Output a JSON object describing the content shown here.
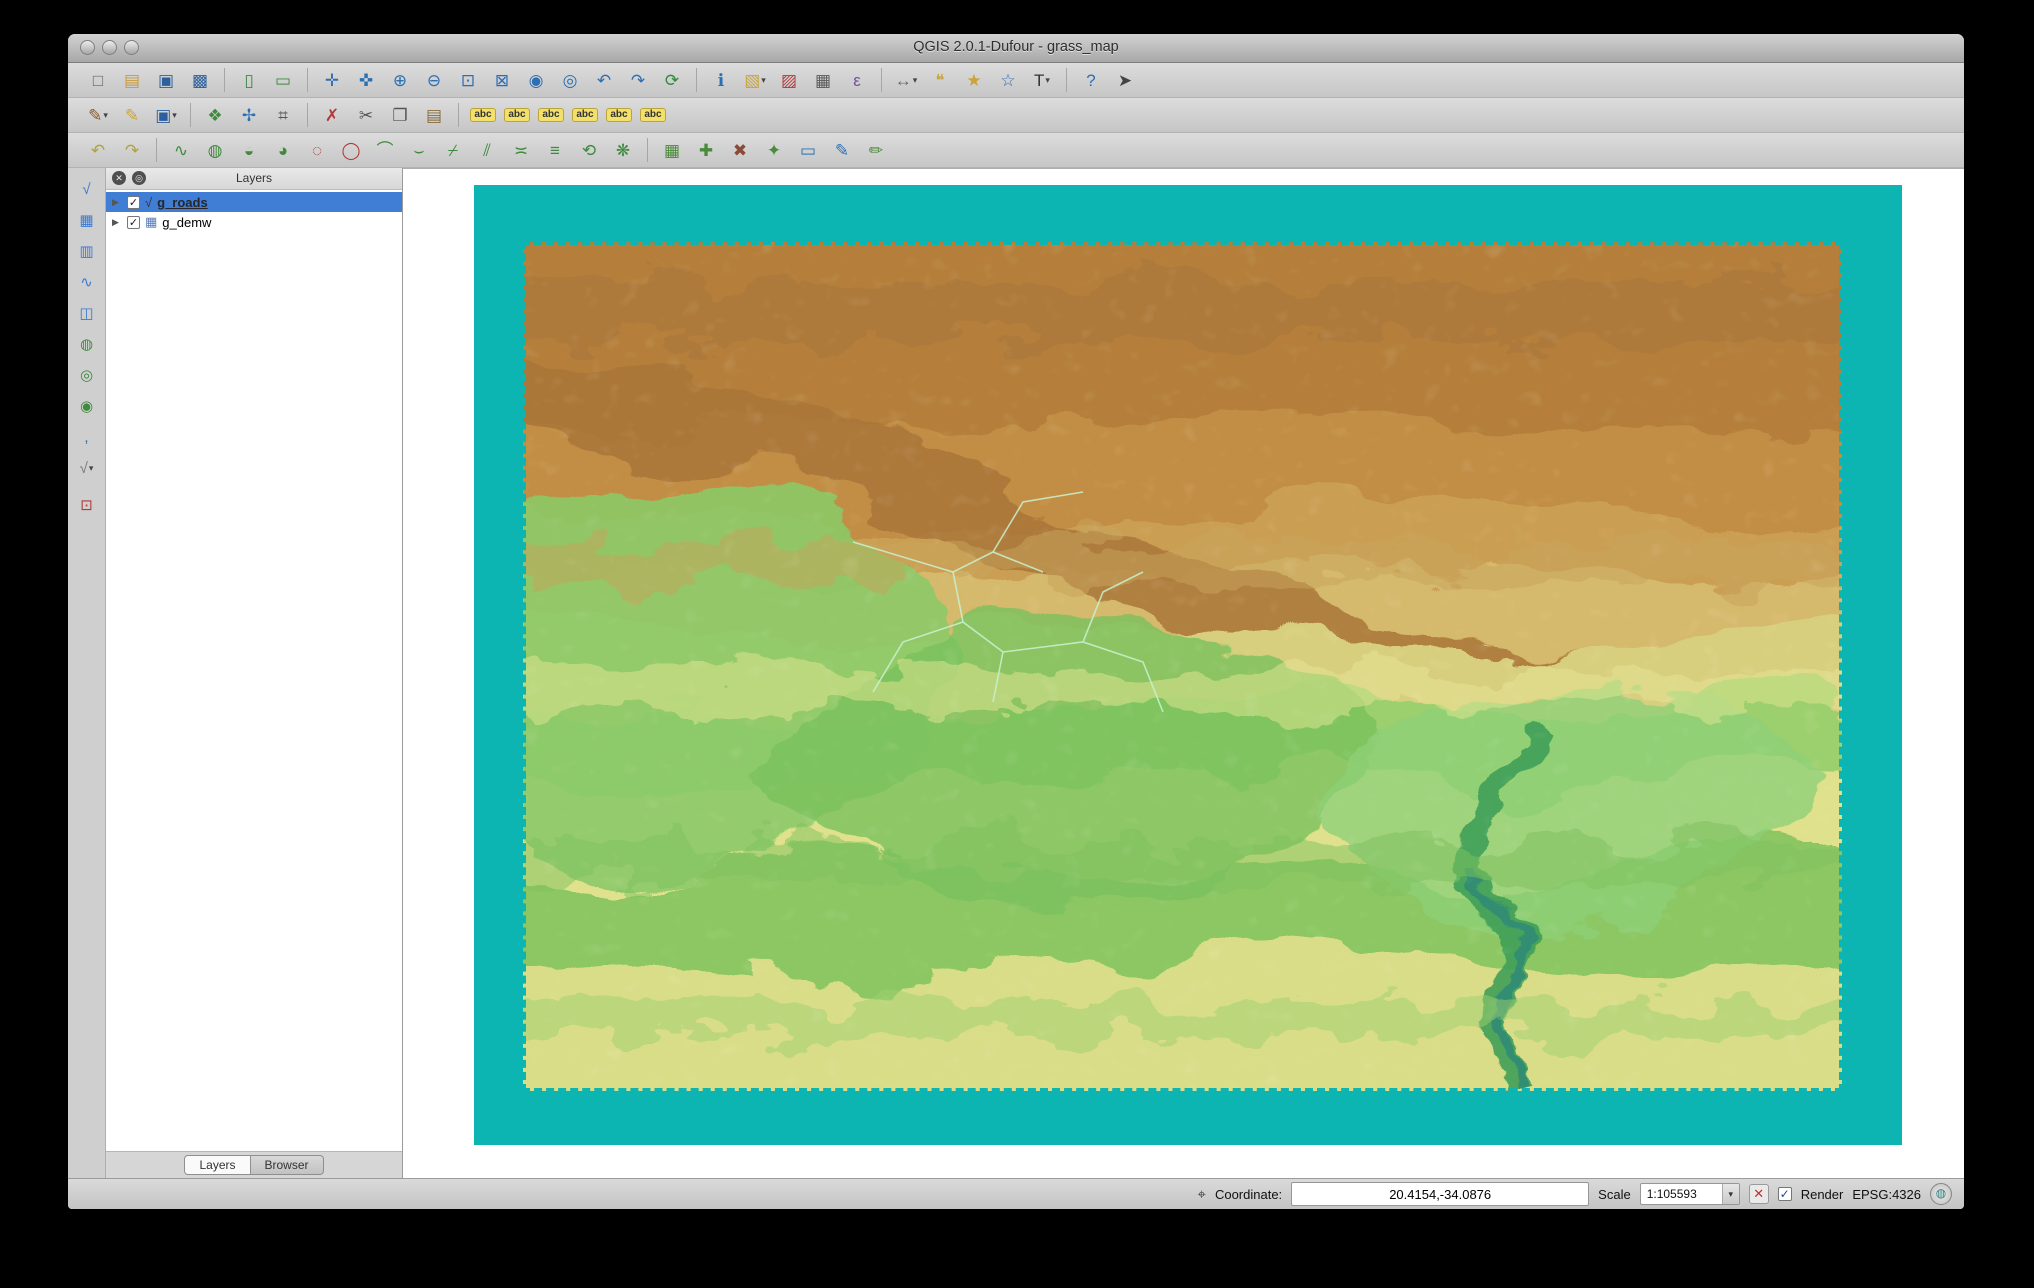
{
  "colors": {
    "teal": "#0db5b2",
    "selection": "#3f7ed4"
  },
  "ui": {
    "dropdown_arrow": "▾",
    "checkmark": "✓"
  },
  "window": {
    "title": "QGIS 2.0.1-Dufour - grass_map"
  },
  "toolbar_row1": [
    {
      "name": "new-project",
      "glyph": "□",
      "color": "#666666"
    },
    {
      "name": "open-project",
      "glyph": "▤",
      "color": "#c79a3e"
    },
    {
      "name": "save-project",
      "glyph": "▣",
      "color": "#2c5f9e"
    },
    {
      "name": "save-project-as",
      "glyph": "▩",
      "color": "#2c5f9e"
    },
    {
      "sep": true
    },
    {
      "name": "new-print-composer",
      "glyph": "▯",
      "color": "#3f8a3f"
    },
    {
      "name": "composer-manager",
      "glyph": "▭",
      "color": "#3f8a3f"
    },
    {
      "sep": true
    },
    {
      "name": "pan-map",
      "glyph": "✛",
      "color": "#2c6fb3"
    },
    {
      "name": "pan-to-selection",
      "glyph": "✜",
      "color": "#2c6fb3"
    },
    {
      "name": "zoom-in",
      "glyph": "⊕",
      "color": "#2c6fb3"
    },
    {
      "name": "zoom-out",
      "glyph": "⊖",
      "color": "#2c6fb3"
    },
    {
      "name": "zoom-native",
      "glyph": "⊡",
      "color": "#2c6fb3"
    },
    {
      "name": "zoom-full",
      "glyph": "⊠",
      "color": "#2c6fb3"
    },
    {
      "name": "zoom-to-selection",
      "glyph": "◉",
      "color": "#2c6fb3"
    },
    {
      "name": "zoom-to-layer",
      "glyph": "◎",
      "color": "#2c6fb3"
    },
    {
      "name": "zoom-last",
      "glyph": "↶",
      "color": "#2c6fb3"
    },
    {
      "name": "zoom-next",
      "glyph": "↷",
      "color": "#2c6fb3"
    },
    {
      "name": "refresh-map",
      "glyph": "⟳",
      "color": "#2e8b3a"
    },
    {
      "sep": true
    },
    {
      "name": "identify-features",
      "glyph": "ℹ",
      "color": "#2c6fb3"
    },
    {
      "name": "select-features",
      "glyph": "▧",
      "color": "#c9a43c",
      "arrow": true
    },
    {
      "name": "deselect-features",
      "glyph": "▨",
      "color": "#b23a3a"
    },
    {
      "name": "open-attribute-table",
      "glyph": "▦",
      "color": "#5a5a5a"
    },
    {
      "name": "field-calculator",
      "glyph": "ε",
      "color": "#7a4f9f"
    },
    {
      "sep": true
    },
    {
      "name": "measure",
      "glyph": "↔",
      "color": "#6a6a6a",
      "arrow": true
    },
    {
      "name": "map-tips",
      "glyph": "❝",
      "color": "#c9a43c"
    },
    {
      "name": "new-bookmark",
      "glyph": "★",
      "color": "#c9a43c"
    },
    {
      "name": "show-bookmarks",
      "glyph": "☆",
      "color": "#2c6fb3"
    },
    {
      "name": "text-annotation",
      "glyph": "T",
      "color": "#333333",
      "arrow": true
    },
    {
      "sep": true
    },
    {
      "name": "help",
      "glyph": "?",
      "color": "#2c6fb3"
    },
    {
      "name": "whats-this",
      "glyph": "➤",
      "color": "#444444"
    }
  ],
  "toolbar_row2": [
    {
      "name": "current-edits",
      "glyph": "✎",
      "color": "#8a5a2a",
      "arrow": true
    },
    {
      "name": "toggle-editing",
      "glyph": "✎",
      "color": "#c9a43c"
    },
    {
      "name": "save-layer-edits",
      "glyph": "▣",
      "color": "#2c5f9e",
      "arrow": true
    },
    {
      "sep": true
    },
    {
      "name": "add-feature",
      "glyph": "❖",
      "color": "#3f8a3f"
    },
    {
      "name": "move-feature",
      "glyph": "✢",
      "color": "#2c6fb3"
    },
    {
      "name": "node-tool",
      "glyph": "⌗",
      "color": "#555555"
    },
    {
      "sep": true
    },
    {
      "name": "delete-selected",
      "glyph": "✗",
      "color": "#b23a3a"
    },
    {
      "name": "cut-features",
      "glyph": "✂",
      "color": "#555555"
    },
    {
      "name": "copy-features",
      "glyph": "❐",
      "color": "#555555"
    },
    {
      "name": "paste-features",
      "glyph": "▤",
      "color": "#8a6b3a"
    },
    {
      "sep": true
    },
    {
      "name": "labeling",
      "glyph": "abc",
      "color": "#333333",
      "small": true
    },
    {
      "name": "pin-labels",
      "glyph": "abc",
      "color": "#333333",
      "small": true
    },
    {
      "name": "highlight-labels",
      "glyph": "abc",
      "color": "#333333",
      "small": true
    },
    {
      "name": "move-label",
      "glyph": "abc",
      "color": "#333333",
      "small": true
    },
    {
      "name": "rotate-label",
      "glyph": "abc",
      "color": "#333333",
      "small": true
    },
    {
      "name": "change-label",
      "glyph": "abc",
      "color": "#333333",
      "small": true
    }
  ],
  "toolbar_row3": [
    {
      "name": "undo",
      "glyph": "↶",
      "color": "#b0a23c"
    },
    {
      "name": "redo",
      "glyph": "↷",
      "color": "#b0a23c"
    },
    {
      "sep": true
    },
    {
      "name": "simplify-feature",
      "glyph": "∿",
      "color": "#3f8a3f"
    },
    {
      "name": "add-ring",
      "glyph": "◍",
      "color": "#3f8a3f"
    },
    {
      "name": "add-part",
      "glyph": "◒",
      "color": "#3f8a3f"
    },
    {
      "name": "fill-ring",
      "glyph": "◕",
      "color": "#3f8a3f"
    },
    {
      "name": "delete-ring",
      "glyph": "◌",
      "color": "#b23a3a"
    },
    {
      "name": "delete-part",
      "glyph": "◯",
      "color": "#b23a3a"
    },
    {
      "name": "reshape-features",
      "glyph": "⌒",
      "color": "#3f8a3f"
    },
    {
      "name": "offset-curve",
      "glyph": "⌣",
      "color": "#3f8a3f"
    },
    {
      "name": "split-features",
      "glyph": "⌿",
      "color": "#3f8a3f"
    },
    {
      "name": "split-parts",
      "glyph": "⫽",
      "color": "#3f8a3f"
    },
    {
      "name": "merge-features",
      "glyph": "≍",
      "color": "#3f8a3f"
    },
    {
      "name": "merge-attributes",
      "glyph": "≡",
      "color": "#3f8a3f"
    },
    {
      "name": "rotate-feature",
      "glyph": "⟲",
      "color": "#3f8a3f"
    },
    {
      "name": "rotate-point-symbols",
      "glyph": "❋",
      "color": "#3f8a3f"
    },
    {
      "sep": true
    },
    {
      "name": "grass-open-mapset",
      "glyph": "▦",
      "color": "#4a8a3a"
    },
    {
      "name": "grass-new-mapset",
      "glyph": "✚",
      "color": "#4a8a3a"
    },
    {
      "name": "grass-close-mapset",
      "glyph": "✖",
      "color": "#8a4a3a"
    },
    {
      "name": "grass-tools",
      "glyph": "✦",
      "color": "#4a8a3a"
    },
    {
      "name": "grass-display-region",
      "glyph": "▭",
      "color": "#2c6fb3"
    },
    {
      "name": "grass-edit-region",
      "glyph": "✎",
      "color": "#2c6fb3"
    },
    {
      "name": "grass-edit-vector",
      "glyph": "✏",
      "color": "#4a8a3a"
    }
  ],
  "left_toolbar": [
    {
      "name": "add-vector-layer",
      "glyph": "√",
      "color": "#3a7ad0"
    },
    {
      "name": "add-raster-layer",
      "glyph": "▦",
      "color": "#3a7ad0"
    },
    {
      "name": "add-postgis-layer",
      "glyph": "▥",
      "color": "#3a7ad0"
    },
    {
      "name": "add-spatialite-layer",
      "glyph": "∿",
      "color": "#3a7ad0"
    },
    {
      "name": "add-mssql-layer",
      "glyph": "◫",
      "color": "#3a7ad0"
    },
    {
      "name": "add-wms-layer",
      "glyph": "◍",
      "color": "#3f8a3f"
    },
    {
      "name": "add-wcs-layer",
      "glyph": "◎",
      "color": "#3f8a3f"
    },
    {
      "name": "add-wfs-layer",
      "glyph": "◉",
      "color": "#3f8a3f"
    },
    {
      "name": "add-delimited-text-layer",
      "glyph": ",",
      "color": "#2c6fb3"
    },
    {
      "name": "new-shapefile-layer",
      "glyph": "√",
      "color": "#777777",
      "arrow": true
    },
    {
      "sep": true
    },
    {
      "name": "new-grass-vector-layer",
      "glyph": "⊡",
      "color": "#b23a3a"
    }
  ],
  "layers_panel": {
    "title": "Layers",
    "twisty_glyph": "▶",
    "line_icon": "√",
    "raster_icon": "▦",
    "header_buttons": [
      {
        "name": "close-panel",
        "glyph": "✕"
      },
      {
        "name": "detach-panel",
        "glyph": "◎"
      }
    ],
    "layers": [
      {
        "name": "g_roads",
        "checked": true,
        "selected": true,
        "type": "line",
        "underline": true
      },
      {
        "name": "g_demw",
        "checked": true,
        "selected": false,
        "type": "raster",
        "underline": false
      }
    ],
    "tabs": [
      {
        "label": "Layers",
        "active": true
      },
      {
        "label": "Browser",
        "active": false
      }
    ]
  },
  "statusbar": {
    "coordinate_label": "Coordinate:",
    "coordinate_value": "20.4154,-34.0876",
    "scale_label": "Scale",
    "scale_value": "1:105593",
    "render_label": "Render",
    "render_checked": true,
    "epsg_label": "EPSG:4326",
    "icons": {
      "coord": "⌖",
      "stop": "✕",
      "crs": "◍"
    }
  }
}
